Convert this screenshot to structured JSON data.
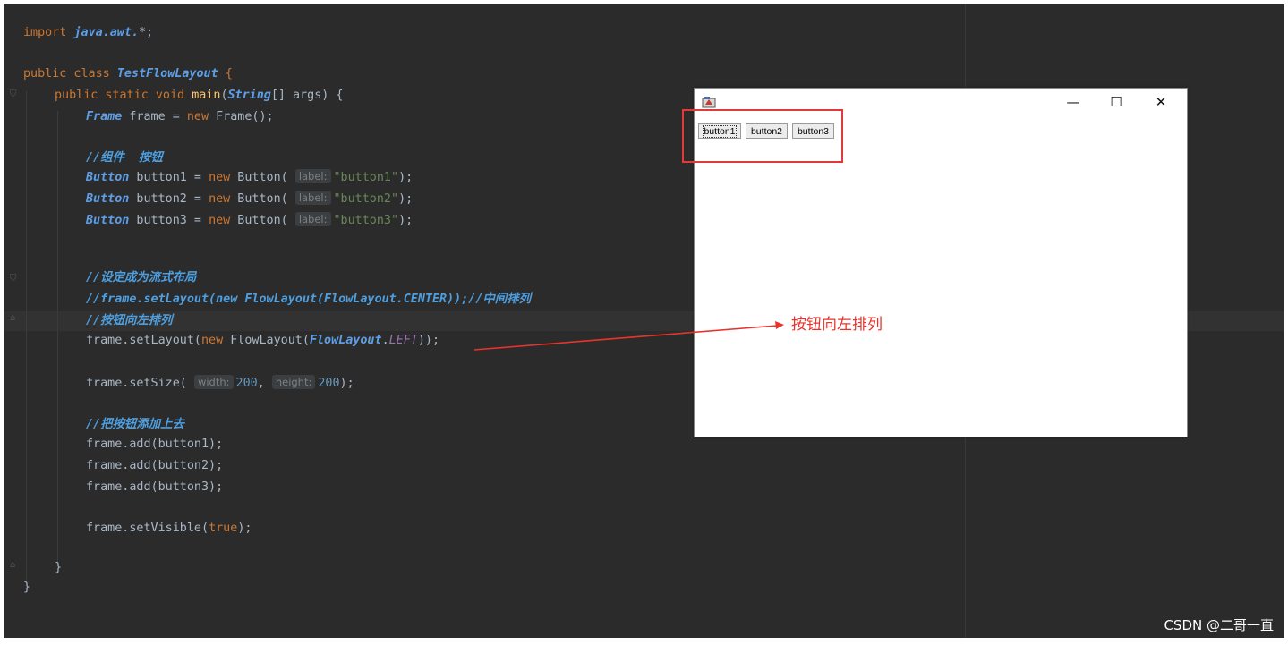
{
  "code": {
    "import": {
      "kw": "import",
      "pkg": "java.awt.",
      "star": "*;"
    },
    "class_decl": {
      "kw": "public class",
      "name": "TestFlowLayout",
      "brace": "{"
    },
    "main_decl": {
      "kw": "public static void",
      "name": "main",
      "open": "(",
      "type": "String",
      "rest": "[] args) {"
    },
    "frame_decl": {
      "type": "Frame",
      "var": " frame = ",
      "kw": "new",
      "call": " Frame();"
    },
    "comment_components": "//组件  按钮",
    "buttons": [
      {
        "type": "Button",
        "var": " button1 = ",
        "kw": "new",
        "call": " Button( ",
        "hint": "label:",
        "arg": "\"button1\"",
        "end": ");"
      },
      {
        "type": "Button",
        "var": " button2 = ",
        "kw": "new",
        "call": " Button( ",
        "hint": "label:",
        "arg": "\"button2\"",
        "end": ");"
      },
      {
        "type": "Button",
        "var": " button3 = ",
        "kw": "new",
        "call": " Button( ",
        "hint": "label:",
        "arg": "\"button3\"",
        "end": ");"
      }
    ],
    "comment_flow": "//设定成为流式布局",
    "comment_center": "//frame.setLayout(new FlowLayout(FlowLayout.CENTER));//中间排列",
    "comment_left": "//按钮向左排列",
    "set_layout": {
      "a": "frame.setLayout(",
      "kw": "new",
      "b": " FlowLayout(",
      "cls": "FlowLayout",
      "dot": ".",
      "cst": "LEFT",
      "end": "));"
    },
    "set_size": {
      "a": "frame.setSize( ",
      "hint_w": "width:",
      "w": "200",
      "comma": ", ",
      "hint_h": "height:",
      "h": "200",
      "end": ");"
    },
    "comment_add": "//把按钮添加上去",
    "adds": [
      "frame.add(button1);",
      "frame.add(button2);",
      "frame.add(button3);"
    ],
    "set_visible": {
      "a": "frame.setVisible(",
      "kw": "true",
      "end": ");"
    },
    "close_method": "}",
    "close_class": "}"
  },
  "frame_window": {
    "controls": {
      "minimize": "—",
      "maximize": "☐",
      "close": "✕"
    },
    "buttons": [
      "button1",
      "button2",
      "button3"
    ]
  },
  "annotation": {
    "text": "按钮向左排列",
    "color": "#e8332d"
  },
  "watermark": "CSDN @二哥一直",
  "colors": {
    "editor_bg": "#2b2b2b",
    "keyword": "#cc7832",
    "string": "#6a8759",
    "comment": "#4e9fe0",
    "highlight": "#e23a3a"
  }
}
